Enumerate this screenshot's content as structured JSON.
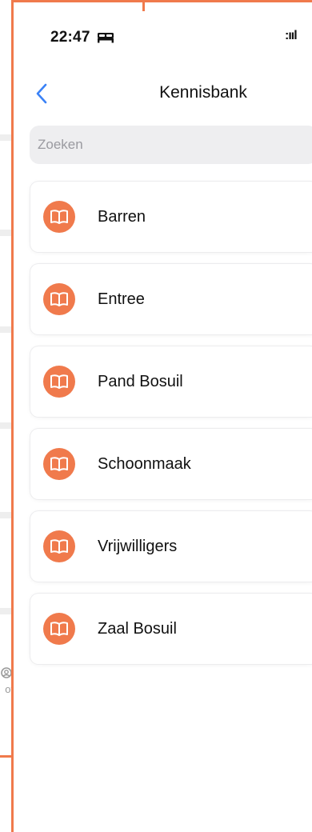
{
  "background_screen": {
    "tab_label_partial": "ofi"
  },
  "status_bar": {
    "time": "22:47",
    "signal_glyph": ":ııl"
  },
  "nav": {
    "title": "Kennisbank"
  },
  "search": {
    "placeholder": "Zoeken",
    "value": ""
  },
  "items": [
    {
      "label": "Barren",
      "icon": "book-icon"
    },
    {
      "label": "Entree",
      "icon": "book-icon"
    },
    {
      "label": "Pand Bosuil",
      "icon": "book-icon"
    },
    {
      "label": "Schoonmaak",
      "icon": "book-icon"
    },
    {
      "label": "Vrijwilligers",
      "icon": "book-icon"
    },
    {
      "label": "Zaal Bosuil",
      "icon": "book-icon"
    }
  ],
  "colors": {
    "accent": "#f07a4c",
    "back_chevron": "#3b82f6",
    "search_bg": "#eeeef0"
  }
}
